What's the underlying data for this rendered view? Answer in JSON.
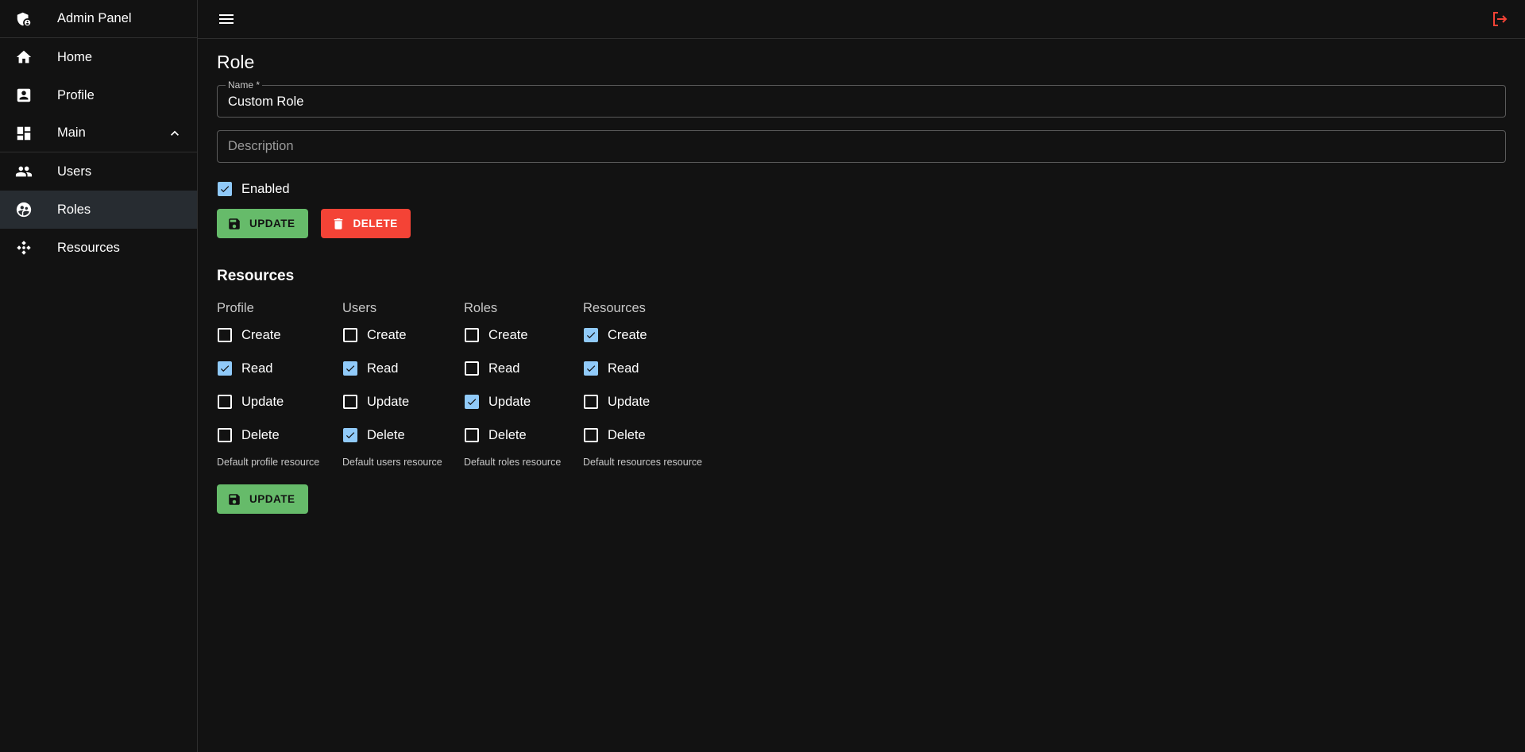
{
  "sidebar": {
    "header": {
      "label": "Admin Panel",
      "icon": "admin-shield-icon"
    },
    "items": [
      {
        "label": "Home",
        "icon": "home-icon"
      },
      {
        "label": "Profile",
        "icon": "profile-icon"
      },
      {
        "label": "Main",
        "icon": "dashboard-icon"
      },
      {
        "label": "Users",
        "icon": "users-icon"
      },
      {
        "label": "Roles",
        "icon": "roles-icon"
      },
      {
        "label": "Resources",
        "icon": "resources-icon"
      }
    ]
  },
  "topbar": {
    "menu_icon": "menu-icon",
    "logout_icon": "logout-icon"
  },
  "page": {
    "title": "Role",
    "name_field": {
      "label": "Name *",
      "value": "Custom Role"
    },
    "description_field": {
      "placeholder": "Description",
      "value": ""
    },
    "enabled": {
      "label": "Enabled",
      "checked": true
    },
    "buttons": {
      "update": "Update",
      "delete": "Delete"
    }
  },
  "resources": {
    "title": "Resources",
    "columns": [
      {
        "title": "Profile",
        "help": "Default profile resource",
        "perms": [
          {
            "label": "Create",
            "checked": false
          },
          {
            "label": "Read",
            "checked": true
          },
          {
            "label": "Update",
            "checked": false
          },
          {
            "label": "Delete",
            "checked": false
          }
        ]
      },
      {
        "title": "Users",
        "help": "Default users resource",
        "perms": [
          {
            "label": "Create",
            "checked": false
          },
          {
            "label": "Read",
            "checked": true
          },
          {
            "label": "Update",
            "checked": false
          },
          {
            "label": "Delete",
            "checked": true
          }
        ]
      },
      {
        "title": "Roles",
        "help": "Default roles resource",
        "perms": [
          {
            "label": "Create",
            "checked": false
          },
          {
            "label": "Read",
            "checked": false
          },
          {
            "label": "Update",
            "checked": true
          },
          {
            "label": "Delete",
            "checked": false
          }
        ]
      },
      {
        "title": "Resources",
        "help": "Default resources resource",
        "perms": [
          {
            "label": "Create",
            "checked": true
          },
          {
            "label": "Read",
            "checked": true
          },
          {
            "label": "Update",
            "checked": false
          },
          {
            "label": "Delete",
            "checked": false
          }
        ]
      }
    ],
    "update_label": "Update"
  },
  "colors": {
    "background": "#121212",
    "selected": "#272c31",
    "checkbox": "#90caf9",
    "update_button": "#66bb6a",
    "delete_button": "#f44336",
    "logout": "#f44336"
  }
}
